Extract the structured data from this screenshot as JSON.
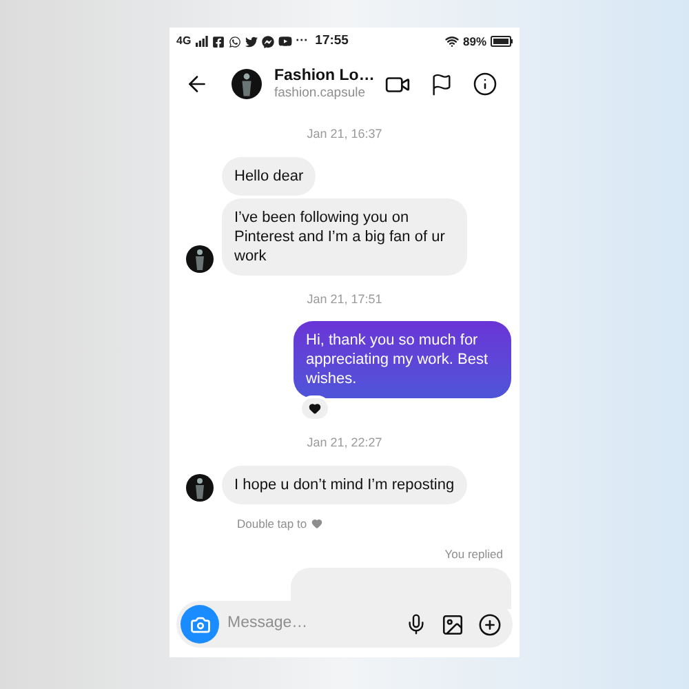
{
  "status_bar": {
    "network": "4G",
    "more": "···",
    "time": "17:55",
    "battery": "89%"
  },
  "header": {
    "title": "Fashion Lo…",
    "username": "fashion.capsule"
  },
  "messages": [
    {
      "kind": "timestamp",
      "text": "Jan 21, 16:37"
    },
    {
      "kind": "incoming",
      "text": "Hello dear",
      "avatar": false
    },
    {
      "kind": "incoming",
      "text": "I’ve been following you on Pinterest and I’m a big fan of ur work",
      "avatar": true
    },
    {
      "kind": "timestamp",
      "text": "Jan 21, 17:51"
    },
    {
      "kind": "outgoing",
      "text": "Hi, thank you so much for appreciating my work. Best wishes.",
      "reaction": true
    },
    {
      "kind": "timestamp",
      "text": "Jan 21, 22:27"
    },
    {
      "kind": "incoming",
      "text": "I hope u don’t mind I’m reposting",
      "avatar": true
    },
    {
      "kind": "hint",
      "text": "Double tap to"
    },
    {
      "kind": "reply_label",
      "text": "You replied"
    },
    {
      "kind": "reply_preview"
    }
  ],
  "composer": {
    "placeholder": "Message…"
  }
}
